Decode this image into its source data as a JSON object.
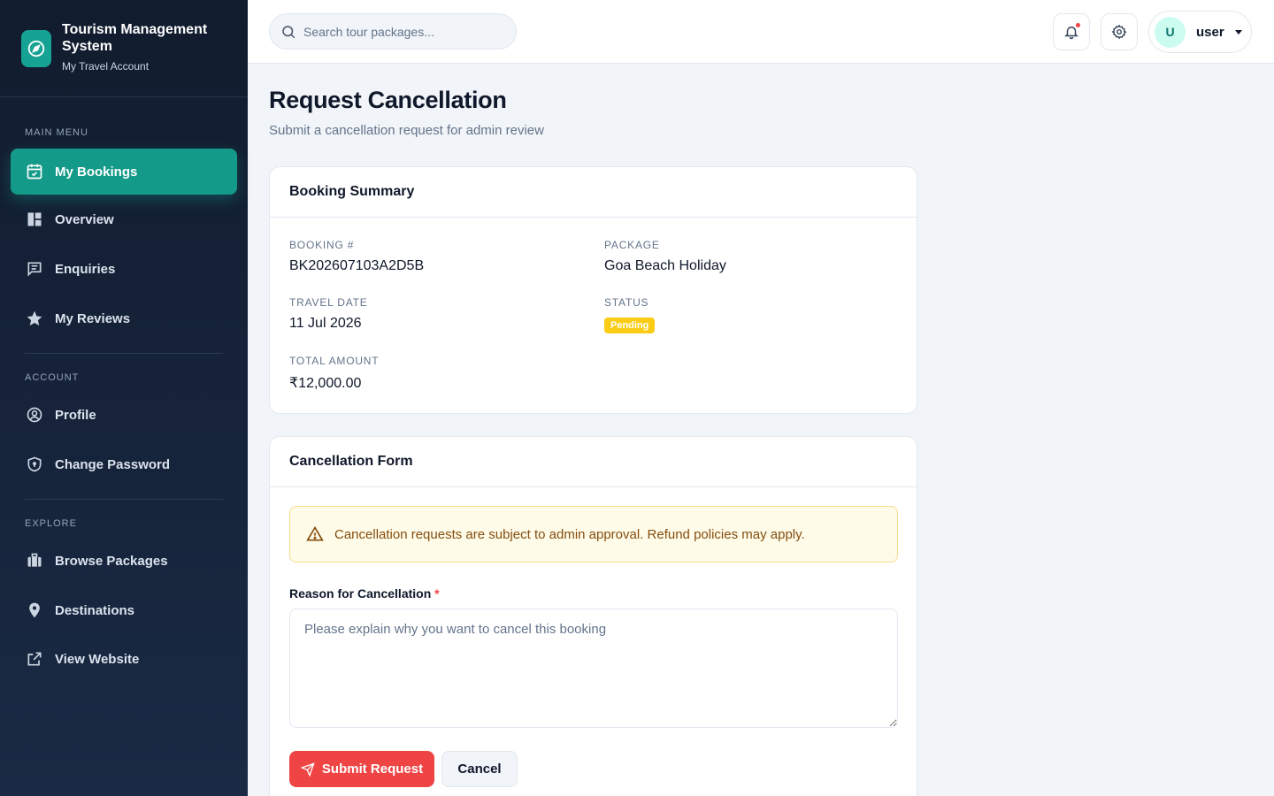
{
  "brand": {
    "title": "Tourism Management System",
    "subtitle": "My Travel Account",
    "icon": "compass-icon"
  },
  "sidebar": {
    "sections": [
      {
        "label": "MAIN MENU"
      },
      {
        "label": "ACCOUNT"
      },
      {
        "label": "EXPLORE"
      }
    ],
    "items": [
      {
        "label": "My Bookings",
        "icon": "calendar-check-icon",
        "active": true
      },
      {
        "label": "Overview",
        "icon": "dashboard-icon"
      },
      {
        "label": "Enquiries",
        "icon": "chat-icon"
      },
      {
        "label": "My Reviews",
        "icon": "star-icon"
      },
      {
        "label": "Profile",
        "icon": "user-circle-icon"
      },
      {
        "label": "Change Password",
        "icon": "shield-icon"
      },
      {
        "label": "Browse Packages",
        "icon": "suitcase-icon"
      },
      {
        "label": "Destinations",
        "icon": "map-pin-icon"
      },
      {
        "label": "View Website",
        "icon": "external-link-icon"
      }
    ]
  },
  "header": {
    "search_placeholder": "Search tour packages...",
    "user": {
      "initial": "U",
      "name": "user"
    }
  },
  "page": {
    "title": "Request Cancellation",
    "subtitle": "Submit a cancellation request for admin review"
  },
  "summary": {
    "title": "Booking Summary",
    "booking_label": "BOOKING #",
    "booking_value": "BK202607103A2D5B",
    "package_label": "PACKAGE",
    "package_value": "Goa Beach Holiday",
    "date_label": "TRAVEL DATE",
    "date_value": "11 Jul 2026",
    "status_label": "STATUS",
    "status_value": "Pending",
    "amount_label": "TOTAL AMOUNT",
    "amount_value": "₹12,000.00"
  },
  "form": {
    "title": "Cancellation Form",
    "alert": "Cancellation requests are subject to admin approval. Refund policies may apply.",
    "reason_label": "Reason for Cancellation",
    "required_mark": "*",
    "reason_placeholder": "Please explain why you want to cancel this booking",
    "submit_label": "Submit Request",
    "cancel_label": "Cancel"
  },
  "colors": {
    "accent": "#139a88",
    "danger": "#ef4444",
    "warning": "#facc15",
    "sidebar": "#152238"
  }
}
